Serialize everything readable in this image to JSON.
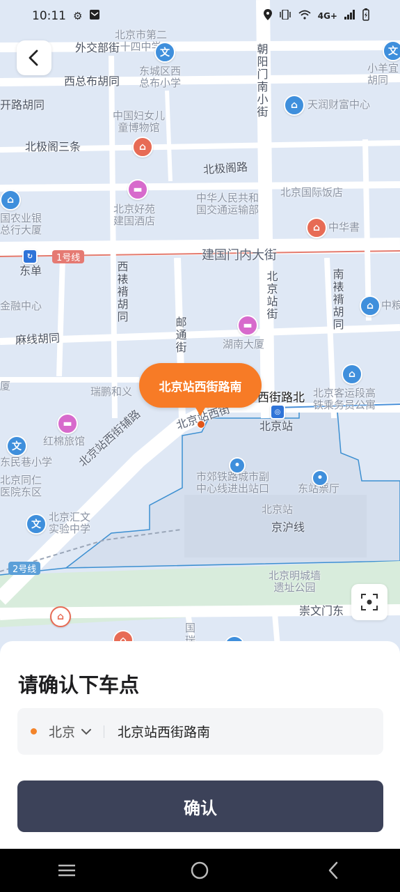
{
  "status_bar": {
    "time": "10:11",
    "network": "4G+"
  },
  "map": {
    "labels": [
      {
        "text": "北京市第二\n十四中学",
        "kind": "normal"
      },
      {
        "text": "外交部街",
        "kind": "dark"
      },
      {
        "text": "东城区西\n总布小学",
        "kind": "normal"
      },
      {
        "text": "西总布胡同",
        "kind": "dark"
      },
      {
        "text": "中国妇女儿\n童博物馆",
        "kind": "normal"
      },
      {
        "text": "北极阁三条",
        "kind": "dark"
      },
      {
        "text": "北极阁路",
        "kind": "dark"
      },
      {
        "text": "天润财富中心",
        "kind": "normal"
      },
      {
        "text": "中华人民共和\n国交通运输部",
        "kind": "normal"
      },
      {
        "text": "北京国际饭店",
        "kind": "normal"
      },
      {
        "text": "北京好苑\n建国酒店",
        "kind": "normal"
      },
      {
        "text": "中华書",
        "kind": "normal"
      },
      {
        "text": "建国门内大街",
        "kind": "road"
      },
      {
        "text": "1号线",
        "kind": "line"
      },
      {
        "text": "东单",
        "kind": "dark"
      },
      {
        "text": "金融中心",
        "kind": "normal"
      },
      {
        "text": "麻线胡同",
        "kind": "dark"
      },
      {
        "text": "湖南大厦",
        "kind": "normal"
      },
      {
        "text": "瑞鹏和义",
        "kind": "normal"
      },
      {
        "text": "西街路北",
        "kind": "black"
      },
      {
        "text": "北京站",
        "kind": "dark"
      },
      {
        "text": "北京客运段高\n铁乘务员公寓",
        "kind": "normal"
      },
      {
        "text": "红棉旅馆",
        "kind": "normal"
      },
      {
        "text": "北京站西街辅路",
        "kind": "road"
      },
      {
        "text": "北京站西街",
        "kind": "road"
      },
      {
        "text": "市郊铁路城市副\n中心线进出站口",
        "kind": "normal"
      },
      {
        "text": "东站票厅",
        "kind": "normal"
      },
      {
        "text": "东民巷小学",
        "kind": "normal"
      },
      {
        "text": "北京同仁\n医院东区",
        "kind": "normal"
      },
      {
        "text": "北京站",
        "kind": "normal"
      },
      {
        "text": "京沪线",
        "kind": "dark"
      },
      {
        "text": "北京汇文\n实验中学",
        "kind": "normal"
      },
      {
        "text": "2号线",
        "kind": "line"
      },
      {
        "text": "北京明城墙\n遗址公园",
        "kind": "normal"
      },
      {
        "text": "崇文门东",
        "kind": "dark"
      },
      {
        "text": "朝阳门南小街",
        "kind": "vert"
      },
      {
        "text": "西裱褙胡同",
        "kind": "vert"
      },
      {
        "text": "邮通街",
        "kind": "vert"
      },
      {
        "text": "北京站街",
        "kind": "vert"
      },
      {
        "text": "南裱褙胡同",
        "kind": "vert"
      },
      {
        "text": "小羊宜\n胡同",
        "kind": "normal"
      },
      {
        "text": "开路胡同",
        "kind": "dark"
      },
      {
        "text": "国农业银\n总行大厦",
        "kind": "normal"
      },
      {
        "text": "中粮",
        "kind": "normal"
      },
      {
        "text": "厦",
        "kind": "normal"
      },
      {
        "text": "国瑞",
        "kind": "vert"
      }
    ],
    "pin_label": "北京站西街路南"
  },
  "sheet": {
    "title": "请确认下车点",
    "city": "北京",
    "address": "北京站西街路南",
    "confirm_label": "确认"
  },
  "colors": {
    "pin": "#f77b26",
    "confirm_button": "#3c4259",
    "map_background": "#dfe8f5"
  },
  "icons": [
    "back-arrow-icon",
    "locate-icon",
    "settings-icon",
    "mail-icon",
    "location-icon",
    "vibrate-icon",
    "wifi-icon",
    "signal-icon",
    "battery-icon",
    "chevron-down-icon",
    "menu-icon",
    "home-circle-icon",
    "nav-back-icon"
  ]
}
